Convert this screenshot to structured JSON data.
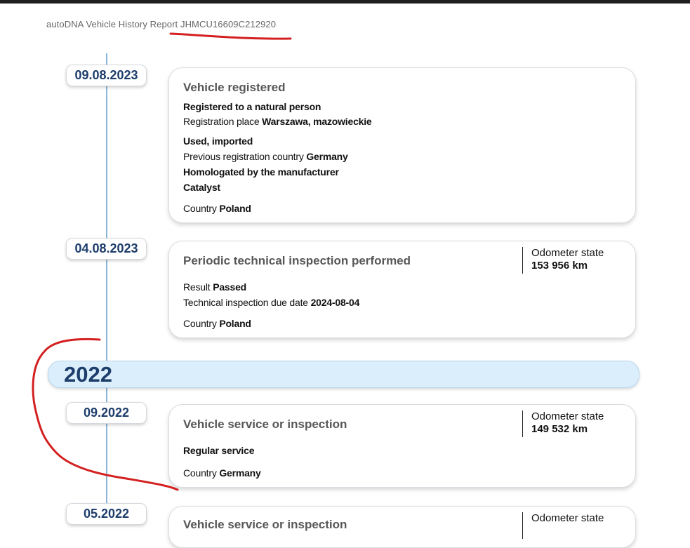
{
  "header": {
    "title": "autoDNA Vehicle History Report JHMCU16609C212920"
  },
  "events": [
    {
      "date": "09.08.2023",
      "title": "Vehicle registered",
      "lines": [
        {
          "label": "",
          "value": "Registered to a natural person"
        },
        {
          "label": "Registration place ",
          "value": "Warszawa, mazowieckie"
        },
        {
          "label": "",
          "value": "Used, imported"
        },
        {
          "label": "Previous registration country ",
          "value": "Germany"
        },
        {
          "label": "",
          "value": "Homologated by the manufacturer"
        },
        {
          "label": "",
          "value": "Catalyst"
        },
        {
          "label": "Country ",
          "value": "Poland"
        }
      ]
    },
    {
      "date": "04.08.2023",
      "title": "Periodic technical inspection performed",
      "odometer_label": "Odometer state",
      "odometer_value": "153 956 km",
      "lines": [
        {
          "label": "Result ",
          "value": "Passed"
        },
        {
          "label": "Technical inspection due date ",
          "value": "2024-08-04"
        },
        {
          "label": "Country ",
          "value": "Poland"
        }
      ]
    },
    {
      "date": "09.2022",
      "title": "Vehicle service or inspection",
      "odometer_label": "Odometer state",
      "odometer_value": "149 532 km",
      "lines": [
        {
          "label": "",
          "value": "Regular service"
        },
        {
          "label": "Country ",
          "value": "Germany"
        }
      ]
    },
    {
      "date": "05.2022",
      "title": "Vehicle service or inspection",
      "odometer_label": "Odometer state"
    }
  ],
  "year_band": {
    "year": "2022"
  },
  "colors": {
    "accent": "#1d3d6b",
    "timeline": "#8ab6d8",
    "year_band": "#dbeefb",
    "annotation": "#d42020"
  }
}
